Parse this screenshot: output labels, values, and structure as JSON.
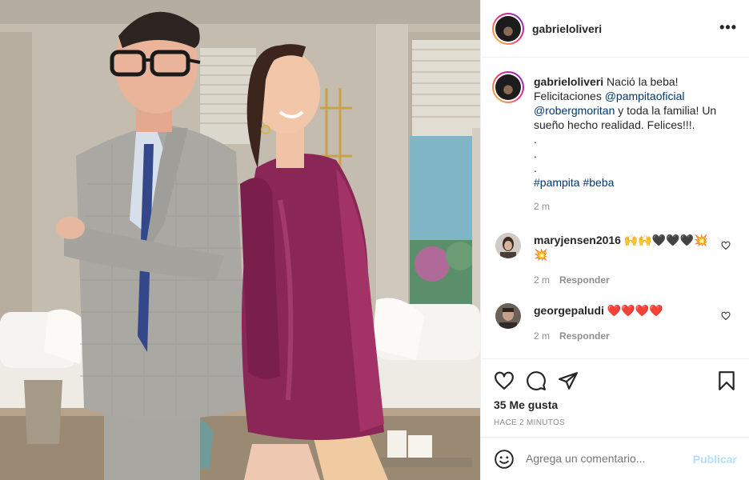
{
  "post": {
    "username": "gabrieloliveri",
    "more_label": "•••",
    "caption": {
      "text_1": "Nació la beba! Felicitaciones ",
      "mention_1": "@pampitaoficial",
      "mention_2": "@robergmoritan",
      "text_2": " y toda la familia! Un sueño hecho realidad. Felices!!!.",
      "dots": [
        ".",
        ".",
        "."
      ],
      "tag_1": "#pampita",
      "tag_2": "#beba",
      "time": "2 m"
    },
    "comments": [
      {
        "username": "maryjensen2016",
        "text": "🙌🙌🖤🖤🖤💥 💥",
        "time": "2 m",
        "reply": "Responder"
      },
      {
        "username": "georgepaludi",
        "text": "❤️❤️❤️❤️",
        "time": "2 m",
        "reply": "Responder"
      }
    ],
    "likes_label": "35 Me gusta",
    "time_ago": "HACE 2 MINUTOS",
    "comment_placeholder": "Agrega un comentario...",
    "post_button": "Publicar"
  },
  "icons": {
    "like": "heart-icon",
    "comment": "comment-bubble-icon",
    "share": "paper-plane-icon",
    "save": "bookmark-icon",
    "emoji": "smiley-icon",
    "more": "more-dots-icon"
  },
  "colors": {
    "link": "#00376b",
    "muted": "#8e8e8e",
    "post_button_disabled": "#b2dffc",
    "border": "#efefef"
  }
}
